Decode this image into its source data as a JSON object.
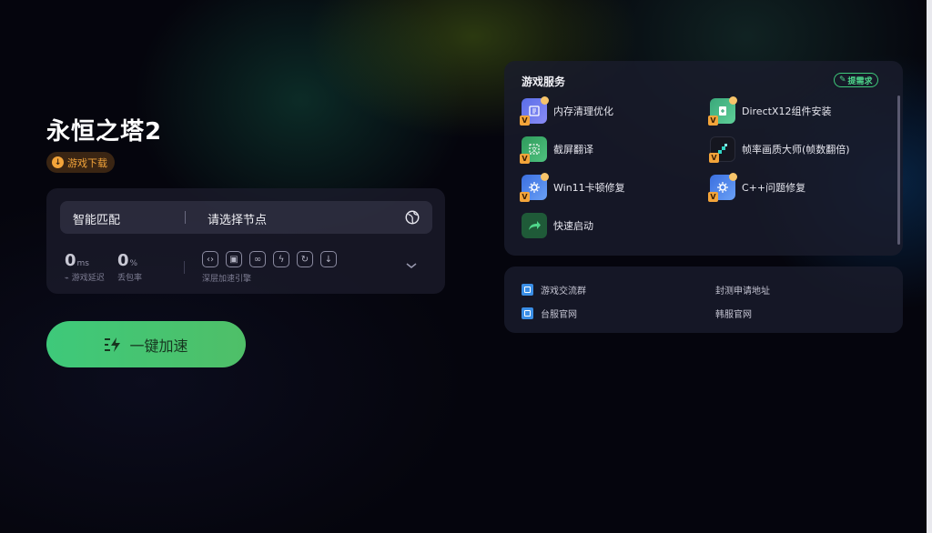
{
  "game": {
    "title": "永恒之塔2",
    "download_label": "游戏下载"
  },
  "accelerator": {
    "smart_match": "智能匹配",
    "node_placeholder": "请选择节点",
    "latency_value": "0",
    "latency_unit": "ms",
    "latency_label": "游戏延迟",
    "loss_value": "0",
    "loss_unit": "%",
    "loss_label": "丢包率",
    "deep_engine_label": "深层加速引擎",
    "tool_icons": [
      "code-icon",
      "screen-icon",
      "link-icon",
      "flash-icon",
      "sync-icon",
      "download-icon"
    ],
    "boost_label": "一键加速"
  },
  "services": {
    "title": "游戏服务",
    "request_label": "提需求",
    "items": [
      {
        "label": "内存清理优化",
        "icon": "memory-icon"
      },
      {
        "label": "DirectX12组件安装",
        "icon": "directx-icon"
      },
      {
        "label": "截屏翻译",
        "icon": "translate-icon"
      },
      {
        "label": "帧率画质大师(帧数翻倍)",
        "icon": "framerate-icon"
      },
      {
        "label": "Win11卡顿修复",
        "icon": "gear-icon"
      },
      {
        "label": "C++问题修复",
        "icon": "gear-icon"
      },
      {
        "label": "快速启动",
        "icon": "launch-icon"
      }
    ]
  },
  "links": {
    "items": [
      {
        "label": "游戏交流群",
        "has_icon": true
      },
      {
        "label": "封测申请地址",
        "has_icon": false
      },
      {
        "label": "台服官网",
        "has_icon": true
      },
      {
        "label": "韩服官网",
        "has_icon": false
      }
    ]
  },
  "colors": {
    "accent_green": "#3ec97a",
    "accent_orange": "#f3a43a",
    "card_bg": "#1c1c2c"
  }
}
